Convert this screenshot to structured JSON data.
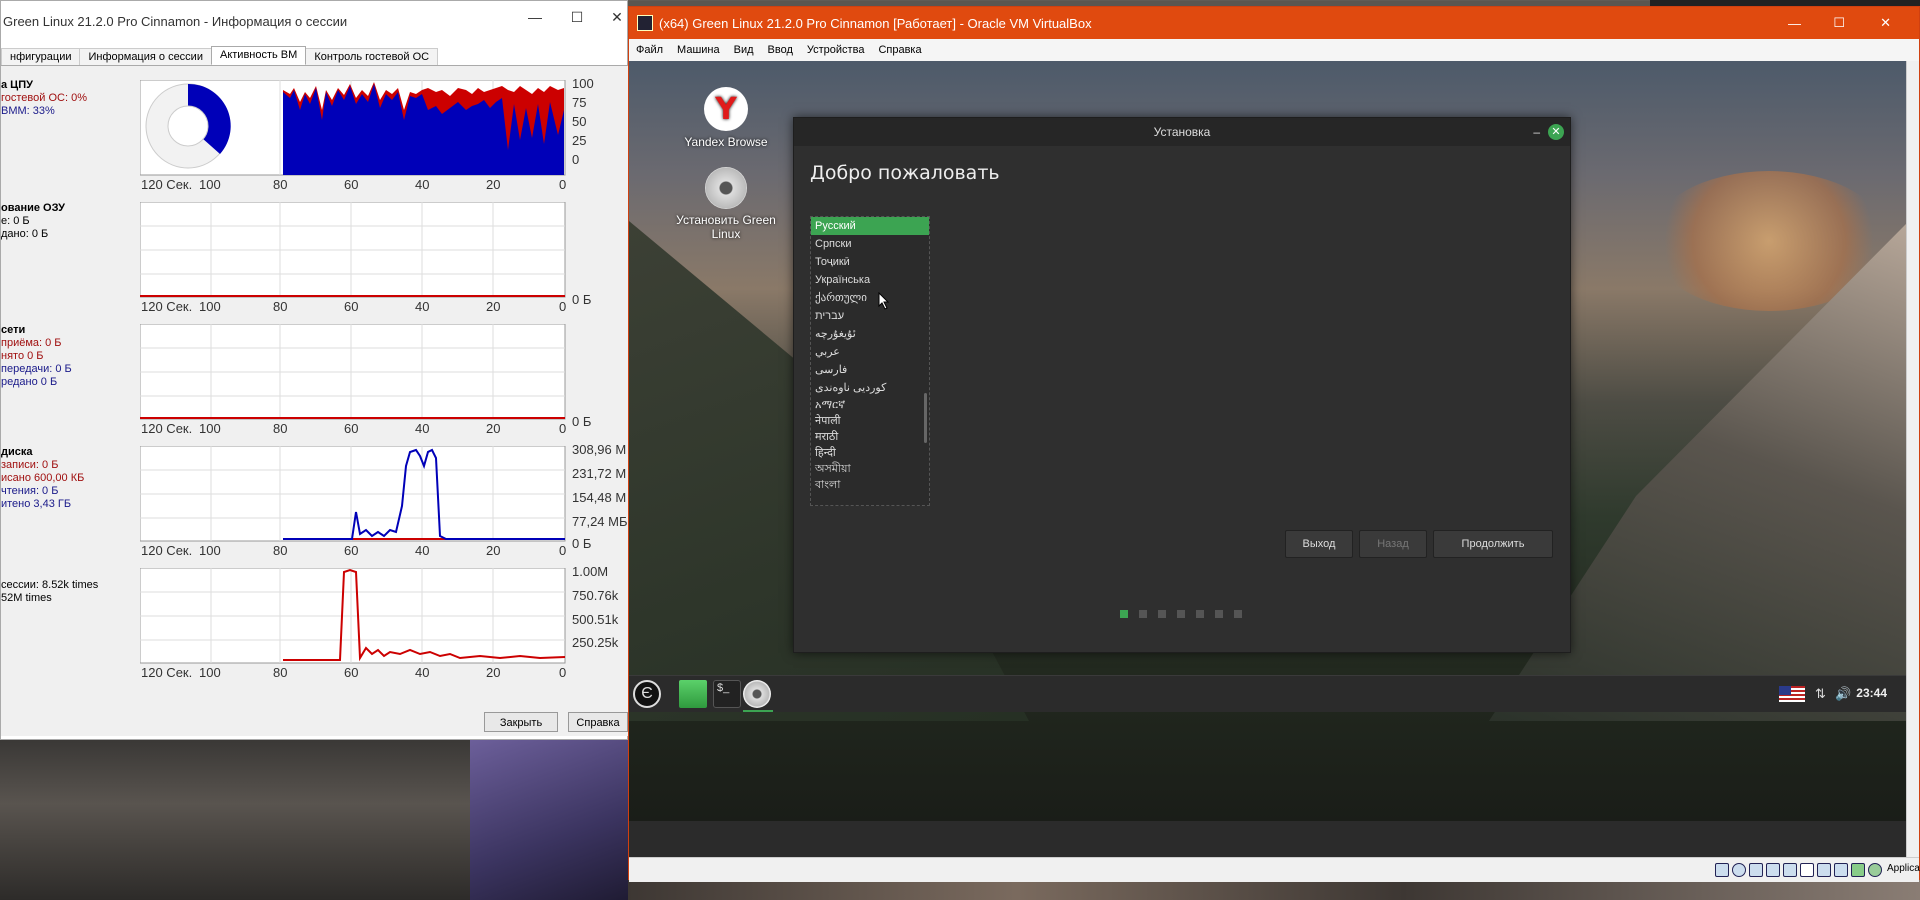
{
  "session_window": {
    "title": "Green Linux 21.2.0 Pro Cinnamon - Информация о сессии",
    "tabs": [
      "нфигурации",
      "Информация о сессии",
      "Активность ВМ",
      "Контроль гостевой ОС"
    ],
    "active_tab": 2,
    "sections": {
      "cpu": {
        "head": "а ЦПУ",
        "lines": [
          "гостевой ОС: 0%",
          "ВММ: 33%"
        ]
      },
      "ram": {
        "head": "ование ОЗУ",
        "lines": [
          "е: 0 Б",
          "дано: 0 Б"
        ]
      },
      "net": {
        "head": "сети",
        "lines": [
          "приёма: 0 Б",
          "нято 0 Б",
          "передачи: 0 Б",
          "редано 0 Б"
        ]
      },
      "disk": {
        "head": "диска",
        "lines": [
          "записи: 0 Б",
          "исано 600,00 КБ",
          "чтения: 0 Б",
          "итено 3,43 ГБ"
        ]
      },
      "vmexit": {
        "lines": [
          "сессии: 8.52k times",
          "52M times"
        ]
      }
    },
    "x_labels": [
      "120 Сек.",
      "100",
      "80",
      "60",
      "40",
      "20",
      "0"
    ],
    "cpu_y_labels": [
      "100",
      "75",
      "50",
      "25",
      "0"
    ],
    "ram_y_label": "0 Б",
    "net_y_label": "0 Б",
    "disk_y_labels": [
      "308,96 М",
      "231,72 М",
      "154,48 М",
      "77,24 МБ",
      "0 Б"
    ],
    "vmexit_y_labels": [
      "1.00M",
      "750.76k",
      "500.51k",
      "250.25k"
    ],
    "buttons": {
      "close": "Закрыть",
      "help": "Справка"
    },
    "colors": {
      "guest": "#cc0000",
      "vmm": "#0000c0"
    }
  },
  "vbox_window": {
    "title": "(x64) Green Linux 21.2.0 Pro Cinnamon [Работает] - Oracle VM VirtualBox",
    "menu": [
      "Файл",
      "Машина",
      "Вид",
      "Ввод",
      "Устройства",
      "Справка"
    ],
    "status_text": "Application"
  },
  "desktop": {
    "icons": [
      {
        "label": "Yandex Browse"
      },
      {
        "label": "Установить Green Linux"
      }
    ]
  },
  "installer": {
    "title": "Установка",
    "heading": "Добро пожаловать",
    "languages": [
      "Русский",
      "Српски",
      "Тоҷикӣ",
      "Українська",
      "ქართული",
      "עברית",
      "ئۇيغۇرچە",
      "عربي",
      "فارسی",
      "کوردیی ناوەندی",
      "አማርኛ",
      "नेपाली",
      "मराठी",
      "हिन्दी",
      "অসমীয়া",
      "বাংলা"
    ],
    "selected_language": 0,
    "buttons": {
      "quit": "Выход",
      "back": "Назад",
      "continue": "Продолжить"
    },
    "step": 1,
    "steps_total": 7,
    "accent": "#3ca452"
  },
  "panel": {
    "clock": "23:44"
  }
}
